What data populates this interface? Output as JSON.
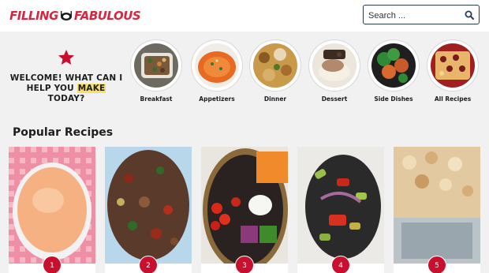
{
  "header": {
    "logo_left": "FILLING",
    "logo_right": "FABULOUS",
    "search_placeholder": "Search ..."
  },
  "welcome": {
    "line1": "WELCOME! WHAT CAN I",
    "line2_pre": "HELP YOU ",
    "line2_highlight": "MAKE",
    "line2_post": " TODAY?"
  },
  "categories": [
    {
      "label": "Breakfast"
    },
    {
      "label": "Appetizers"
    },
    {
      "label": "Dinner"
    },
    {
      "label": "Dessert"
    },
    {
      "label": "Side Dishes"
    },
    {
      "label": "All Recipes"
    }
  ],
  "popular": {
    "title": "Popular Recipes",
    "items": [
      {
        "rank": "1"
      },
      {
        "rank": "2"
      },
      {
        "rank": "3"
      },
      {
        "rank": "4"
      },
      {
        "rank": "5"
      }
    ]
  },
  "colors": {
    "brand": "#d7263d",
    "badge": "#c8102e",
    "highlight": "#f6e067",
    "search_border": "#2b3a55"
  }
}
